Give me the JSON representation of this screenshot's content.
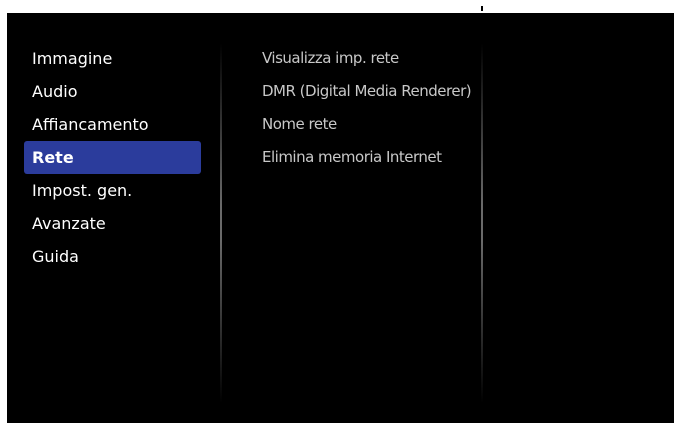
{
  "main_menu": {
    "items": [
      {
        "label": "Immagine",
        "selected": false
      },
      {
        "label": "Audio",
        "selected": false
      },
      {
        "label": "Affiancamento",
        "selected": false
      },
      {
        "label": "Rete",
        "selected": true
      },
      {
        "label": "Impost. gen.",
        "selected": false
      },
      {
        "label": "Avanzate",
        "selected": false
      },
      {
        "label": "Guida",
        "selected": false
      }
    ]
  },
  "submenu": {
    "items": [
      {
        "label": "Visualizza imp. rete"
      },
      {
        "label": "DMR (Digital Media Renderer)"
      },
      {
        "label": "Nome rete"
      },
      {
        "label": "Elimina memoria Internet"
      }
    ]
  },
  "colors": {
    "background": "#000000",
    "selection": "#2b3c9c",
    "main_text": "#ffffff",
    "sub_text": "#c8c8c8"
  }
}
